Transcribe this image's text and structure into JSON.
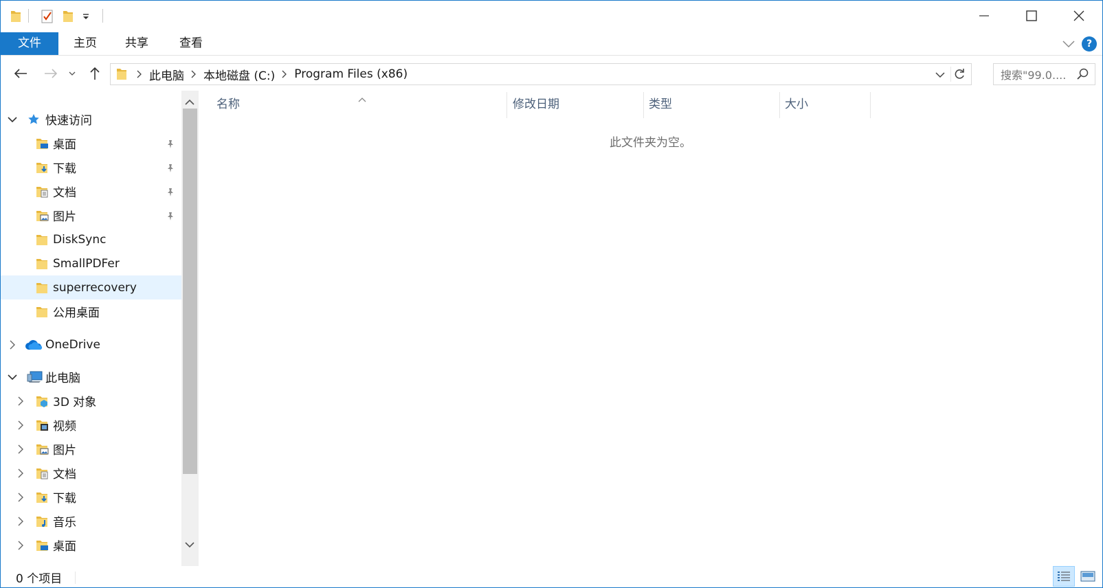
{
  "ribbon": {
    "tabs": [
      "文件",
      "主页",
      "共享",
      "查看"
    ],
    "help_label": "?"
  },
  "address": {
    "crumbs": [
      "此电脑",
      "本地磁盘 (C:)",
      "Program Files (x86)"
    ],
    "search_placeholder": "搜索\"99.0...."
  },
  "sidebar": {
    "quick_access": "快速访问",
    "quick_items": [
      {
        "label": "桌面",
        "icon": "desktop-folder-icon",
        "pinned": true
      },
      {
        "label": "下载",
        "icon": "download-folder-icon",
        "pinned": true
      },
      {
        "label": "文档",
        "icon": "documents-folder-icon",
        "pinned": true
      },
      {
        "label": "图片",
        "icon": "pictures-folder-icon",
        "pinned": true
      },
      {
        "label": "DiskSync",
        "icon": "folder-icon",
        "pinned": false
      },
      {
        "label": "SmallPDFer",
        "icon": "folder-icon",
        "pinned": false
      },
      {
        "label": "superrecovery",
        "icon": "folder-icon",
        "pinned": false
      },
      {
        "label": "公用桌面",
        "icon": "folder-icon",
        "pinned": false
      }
    ],
    "onedrive": "OneDrive",
    "this_pc": "此电脑",
    "pc_items": [
      {
        "label": "3D 对象",
        "icon": "3d-objects-folder-icon"
      },
      {
        "label": "视频",
        "icon": "videos-folder-icon"
      },
      {
        "label": "图片",
        "icon": "pictures-folder-icon"
      },
      {
        "label": "文档",
        "icon": "documents-folder-icon"
      },
      {
        "label": "下载",
        "icon": "download-folder-icon"
      },
      {
        "label": "音乐",
        "icon": "music-folder-icon"
      },
      {
        "label": "桌面",
        "icon": "desktop-folder-icon"
      }
    ]
  },
  "columns": [
    "名称",
    "修改日期",
    "类型",
    "大小"
  ],
  "empty_message": "此文件夹为空。",
  "status": {
    "item_count": "0 个项目"
  },
  "colors": {
    "accent": "#1979ca",
    "selected_bg": "#e5f3ff",
    "folder_yellow": "#f8d775",
    "header_text": "#4c607a"
  }
}
